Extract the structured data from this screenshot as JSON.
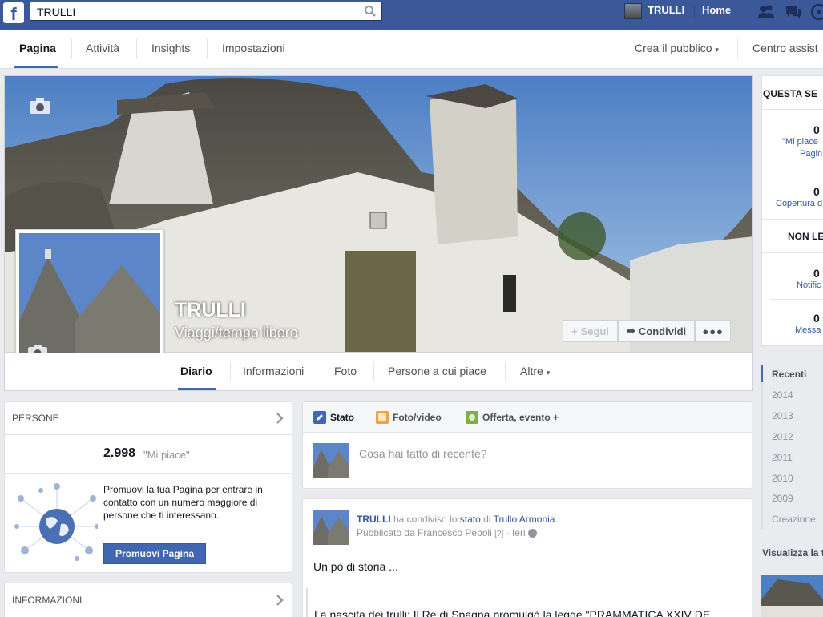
{
  "topbar": {
    "search_value": "TRULLI",
    "profile_name": "TRULLI",
    "home_label": "Home"
  },
  "pagenav": {
    "items": [
      "Pagina",
      "Attività",
      "Insights",
      "Impostazioni"
    ],
    "right_items": [
      "Crea il pubblico",
      "Centro assist"
    ]
  },
  "page": {
    "name": "TRULLI",
    "category": "Viaggi/tempo libero"
  },
  "cover_buttons": {
    "follow": "Segui",
    "share": "Condividi"
  },
  "tabs": [
    "Diario",
    "Informazioni",
    "Foto",
    "Persone a cui piace",
    "Altre"
  ],
  "people": {
    "header": "PERSONE",
    "likes_count": "2.998",
    "likes_label": "\"Mi piace\"",
    "promo_text": "Promuovi la tua Pagina per entrare in contatto con un numero maggiore di persone che ti interessano.",
    "promo_button": "Promuovi Pagina"
  },
  "info": {
    "header": "INFORMAZIONI"
  },
  "composer": {
    "tabs": [
      "Stato",
      "Foto/video",
      "Offerta, evento +"
    ],
    "placeholder": "Cosa hai fatto di recente?"
  },
  "post": {
    "author": "TRULLI",
    "action1": "ha condiviso lo",
    "action_link": "stato",
    "action2": "di",
    "shared_from": "Trullo Armonia.",
    "published_by": "Pubblicato da Francesco Pepoli",
    "help_mark": "[?]",
    "time": "Ieri",
    "text1": "Un pò di storia ...",
    "text2": "La nascita dei trulli: Il Re di Spagna promulgò la legge \"PRAMMATICA XXIV DE"
  },
  "right": {
    "week_header": "QUESTA SE",
    "stat1_num": "0",
    "stat1_label_a": "\"Mi piace",
    "stat1_label_b": "Pagin",
    "stat2_num": "0",
    "stat2_label": "Copertura d",
    "unread_header": "NON LE",
    "stat3_num": "0",
    "stat3_label": "Notific",
    "stat4_num": "0",
    "stat4_label": "Messa",
    "visualize": "Visualizza la t"
  },
  "years": [
    "Recenti",
    "2014",
    "2013",
    "2012",
    "2011",
    "2010",
    "2009",
    "Creazione"
  ]
}
